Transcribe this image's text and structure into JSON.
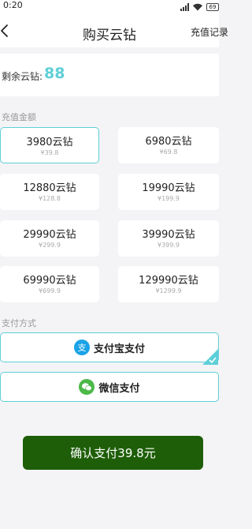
{
  "status": {
    "time": "0:20",
    "battery": "69"
  },
  "nav": {
    "title": "购买云钻",
    "record": "充值记录"
  },
  "balance": {
    "label": "剩余云钻:",
    "value": "88"
  },
  "sections": {
    "amount": "充值金额",
    "payment": "支付方式"
  },
  "packages": [
    {
      "amount": "3980云钻",
      "price": "¥39.8",
      "selected": true
    },
    {
      "amount": "6980云钻",
      "price": "¥69.8",
      "selected": false
    },
    {
      "amount": "12880云钻",
      "price": "¥128.8",
      "selected": false
    },
    {
      "amount": "19990云钻",
      "price": "¥199.9",
      "selected": false
    },
    {
      "amount": "29990云钻",
      "price": "¥299.9",
      "selected": false
    },
    {
      "amount": "39990云钻",
      "price": "¥399.9",
      "selected": false
    },
    {
      "amount": "69990云钻",
      "price": "¥699.9",
      "selected": false
    },
    {
      "amount": "129990云钻",
      "price": "¥1299.9",
      "selected": false
    }
  ],
  "payment": {
    "alipay": {
      "label": "支付宝支付",
      "icon": "alipay-icon",
      "color": "#1aa3e8",
      "selected": true
    },
    "wechat": {
      "label": "微信支付",
      "icon": "wechat-icon",
      "color": "#4cb848",
      "selected": false
    }
  },
  "confirm": {
    "label": "确认支付39.8元"
  },
  "colors": {
    "accent": "#5ecfd8",
    "confirm": "#1e5e08"
  }
}
